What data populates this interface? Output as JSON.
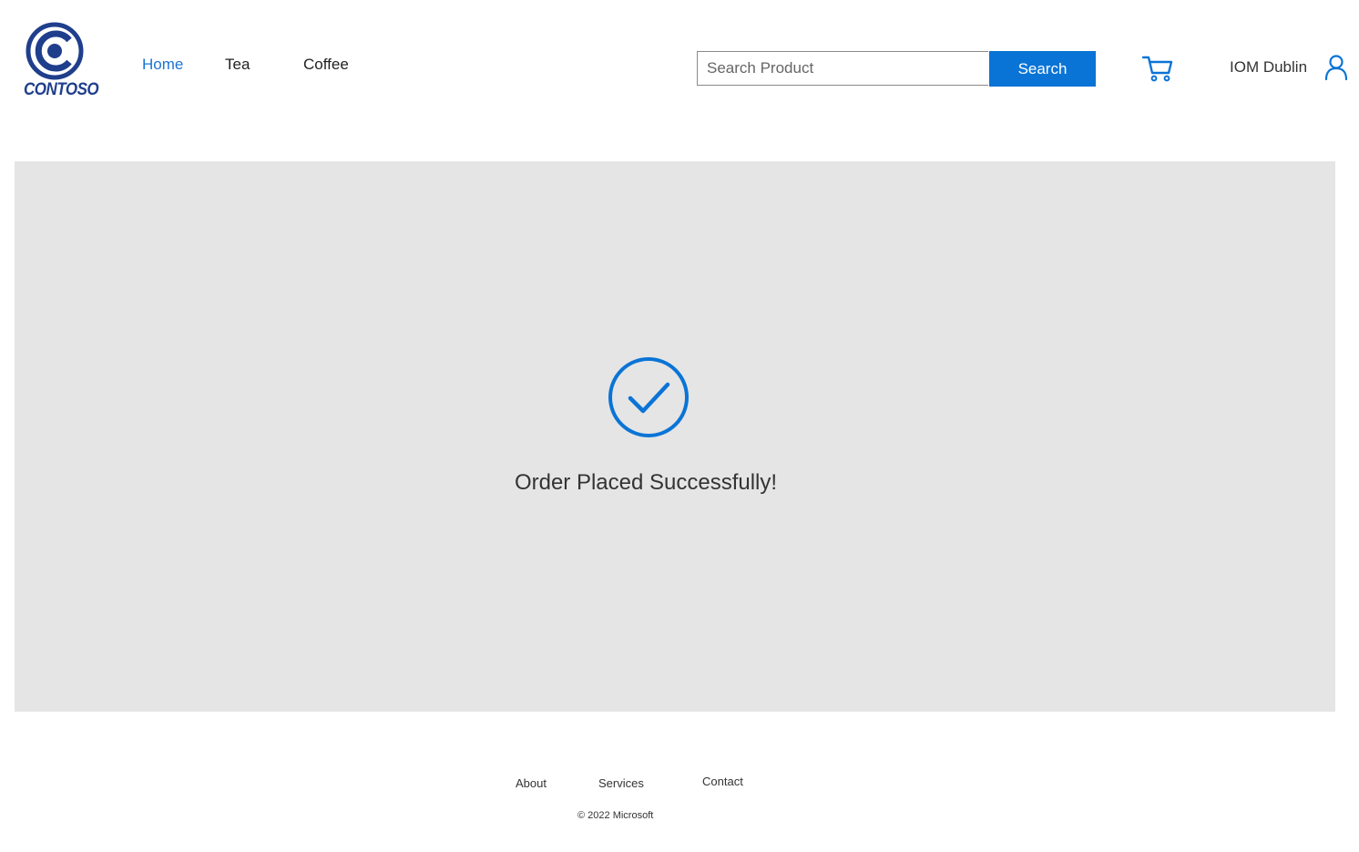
{
  "brand": {
    "logo_text": "CONTOSO",
    "logo_color": "#1f3e8c"
  },
  "nav": {
    "items": [
      {
        "label": "Home",
        "active": true
      },
      {
        "label": "Tea",
        "active": false
      },
      {
        "label": "Coffee",
        "active": false
      }
    ],
    "active_color": "#1a74d6"
  },
  "search": {
    "placeholder": "Search Product",
    "value": "",
    "button_label": "Search",
    "button_color": "#0a74d6"
  },
  "header": {
    "cart_icon": "cart-icon",
    "user_name": "IOM Dublin",
    "user_icon": "user-icon"
  },
  "main": {
    "status_icon": "check-circle-icon",
    "message": "Order Placed Successfully!",
    "panel_color": "#e5e5e5",
    "accent_color": "#0a74d6"
  },
  "footer": {
    "links": [
      "About",
      "Services",
      "Contact"
    ],
    "copyright": "© 2022 Microsoft"
  }
}
